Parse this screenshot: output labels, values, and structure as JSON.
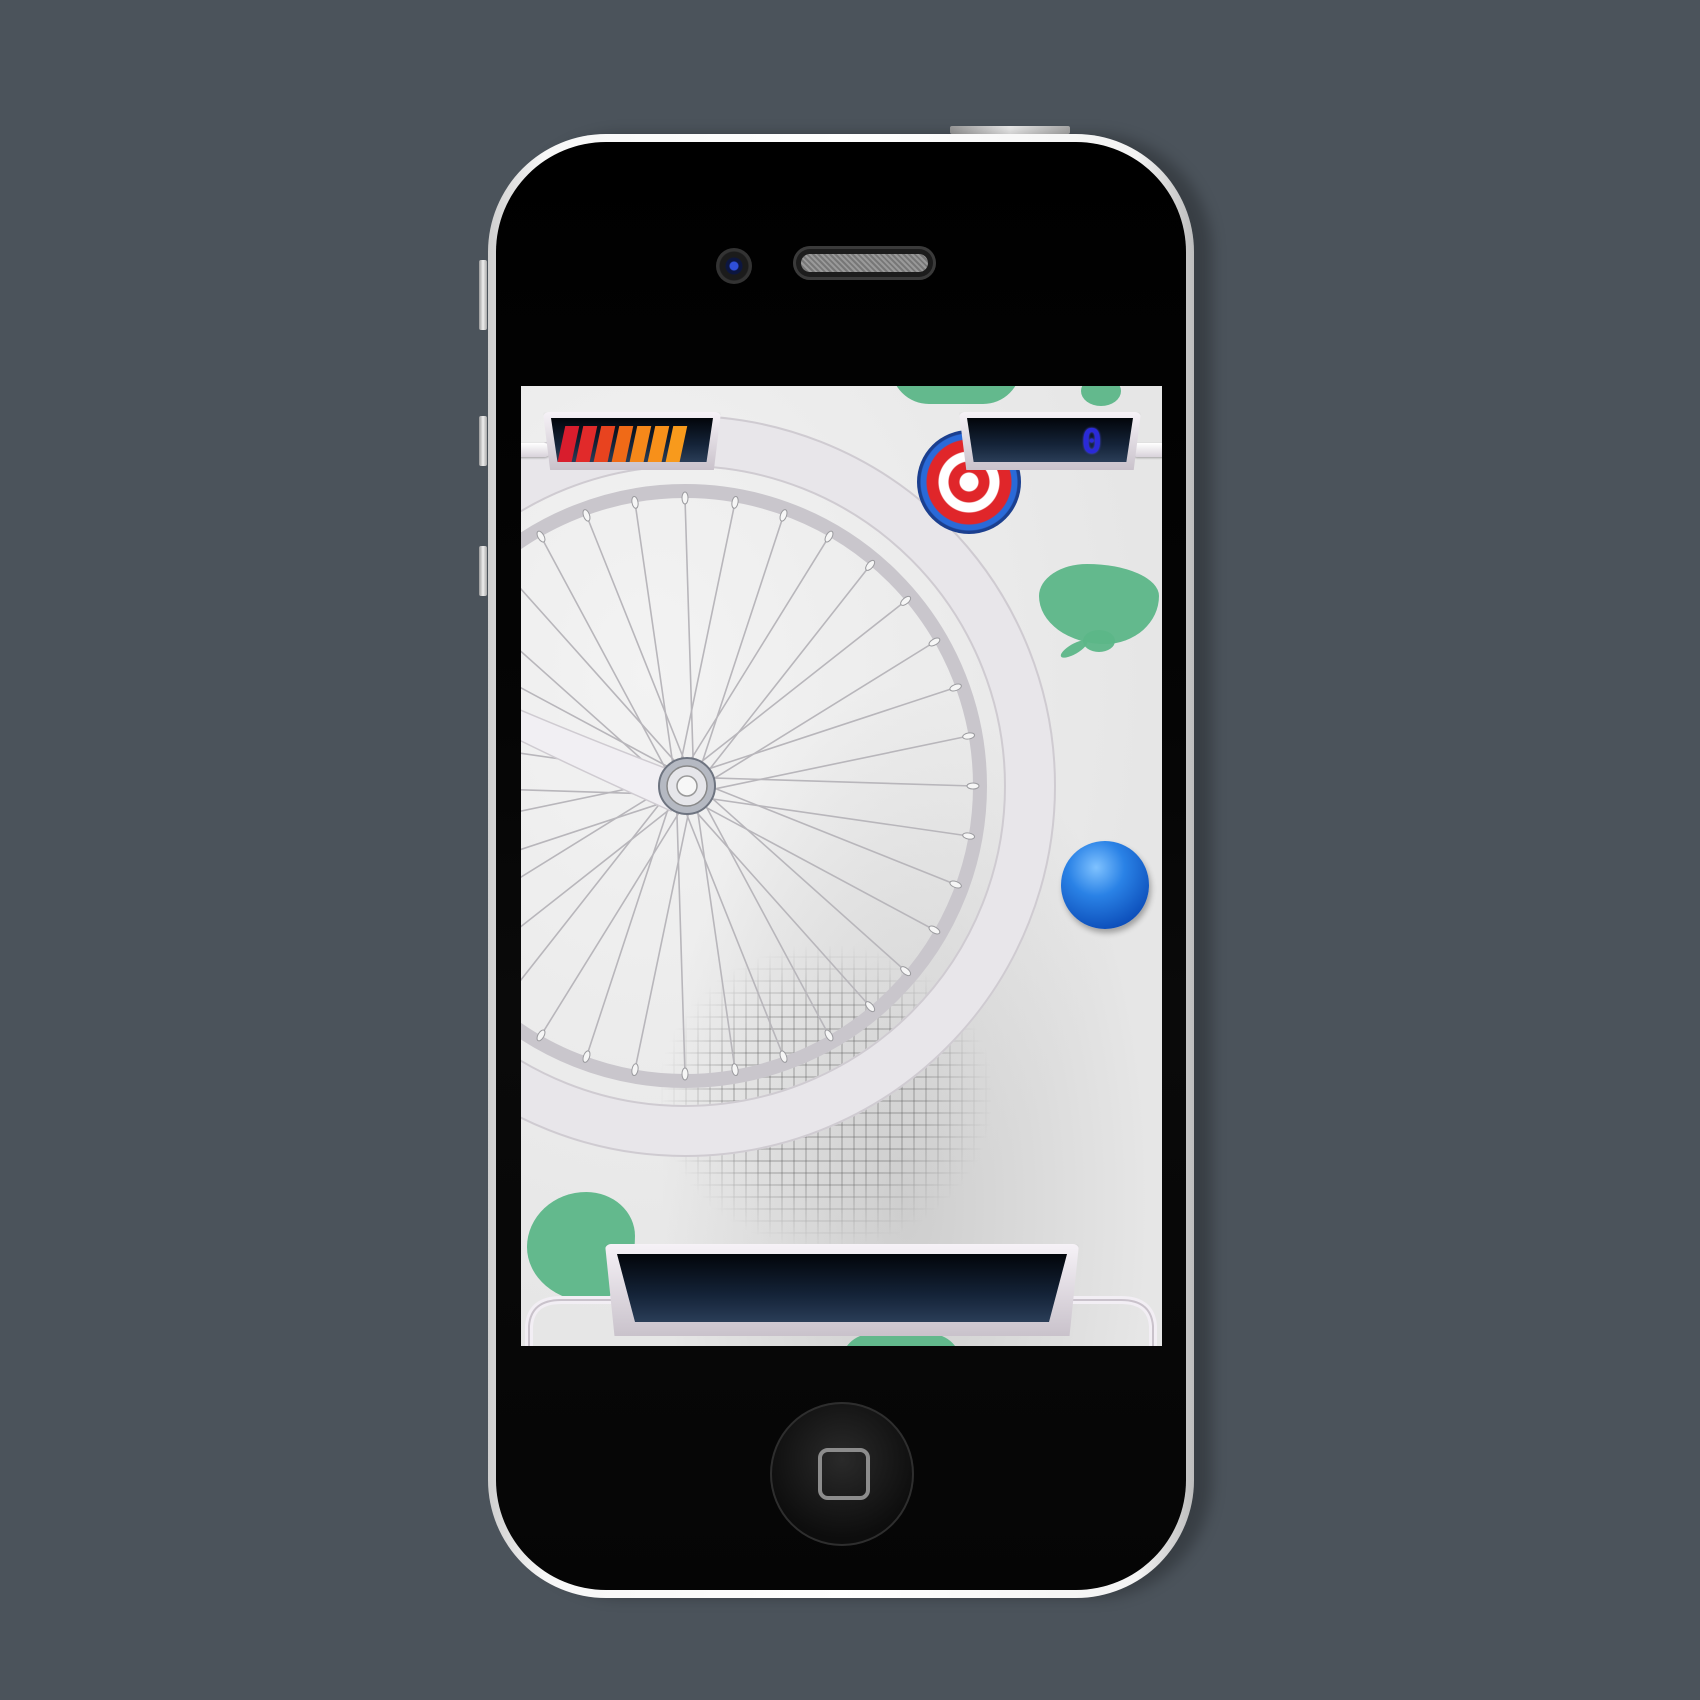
{
  "device": {
    "model": "smartphone",
    "home_button_icon": "home-square-icon"
  },
  "game": {
    "hud": {
      "energy_meter": {
        "filled_bars": 7,
        "total_bars": 7,
        "bar_colors": [
          "#d81d2d",
          "#e12a2a",
          "#e8431f",
          "#f06a17",
          "#f5881a",
          "#f7901a",
          "#f89a1c"
        ]
      },
      "score": {
        "value": "0",
        "color": "#2a2ad8"
      },
      "message_display": {
        "text": ""
      }
    },
    "objects": {
      "target_icon": "bullseye-target-icon",
      "ball_color": "#2a82e6",
      "wheel": "bicycle-wheel",
      "slime_color": "#5cb688"
    }
  }
}
